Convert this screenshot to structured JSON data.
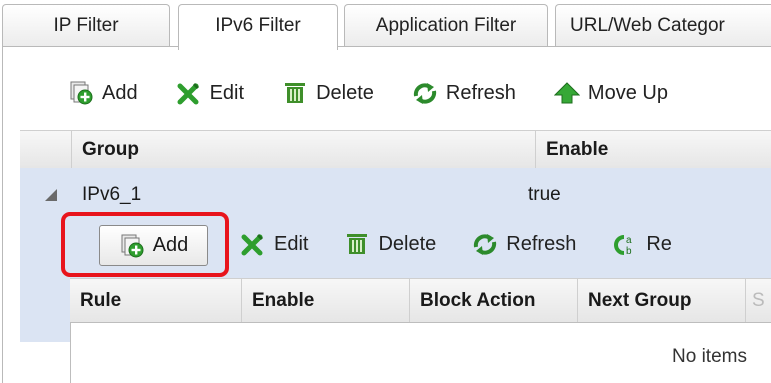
{
  "tabs": [
    {
      "label": "IP Filter"
    },
    {
      "label": "IPv6 Filter"
    },
    {
      "label": "Application Filter"
    },
    {
      "label": "URL/Web Categor"
    }
  ],
  "toolbar": {
    "add": "Add",
    "edit": "Edit",
    "delete": "Delete",
    "refresh": "Refresh",
    "move_up": "Move Up"
  },
  "group_table": {
    "columns": [
      "Group",
      "Enable"
    ],
    "rows": [
      {
        "group": "IPv6_1",
        "enable": "true"
      }
    ]
  },
  "sub_toolbar": {
    "add": "Add",
    "edit": "Edit",
    "delete": "Delete",
    "refresh": "Refresh",
    "rename": "Re"
  },
  "rule_table": {
    "columns": [
      "Rule",
      "Enable",
      "Block Action",
      "Next Group",
      "S"
    ],
    "empty_text": "No items"
  },
  "colors": {
    "highlight_box": "#e8141c",
    "selected_row": "#dbe4f3",
    "add_icon_green": "#2e9e2e",
    "edit_icon_green": "#2e9e2e",
    "delete_icon_green": "#3f8f2a",
    "refresh_icon_green": "#2c8a2c",
    "move_up_icon_green": "#36a836"
  },
  "icons": [
    "add-icon",
    "edit-icon",
    "delete-icon",
    "refresh-icon",
    "move-up-icon",
    "rename-icon",
    "expand-arrow-icon"
  ]
}
